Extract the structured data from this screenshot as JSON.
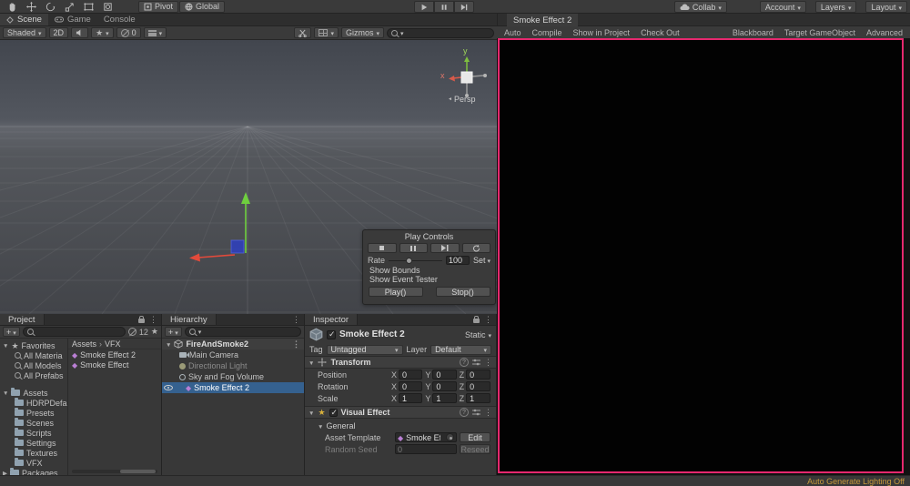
{
  "topbar": {
    "pivot": "Pivot",
    "global": "Global",
    "collab": "Collab",
    "account": "Account",
    "layers": "Layers",
    "layout": "Layout"
  },
  "tabs": {
    "scene": "Scene",
    "game": "Game",
    "console": "Console",
    "vfx": "Smoke Effect 2"
  },
  "scene_toolbar": {
    "shaded": "Shaded",
    "mode2d": "2D",
    "hidden_count": "0",
    "gizmos": "Gizmos"
  },
  "scene_view": {
    "axis_x": "x",
    "axis_y": "y",
    "persp": "Persp"
  },
  "play_controls": {
    "title": "Play Controls",
    "rate": "Rate",
    "rate_value": "100",
    "set": "Set",
    "show_bounds": "Show Bounds",
    "show_event_tester": "Show Event Tester",
    "play": "Play()",
    "stop": "Stop()"
  },
  "vfx_toolbar": {
    "left": [
      "Auto",
      "Compile",
      "Show in Project",
      "Check Out"
    ],
    "right": [
      "Blackboard",
      "Target GameObject",
      "Advanced"
    ]
  },
  "project": {
    "tab": "Project",
    "add": "+",
    "filter_count": "12",
    "favorites": "Favorites",
    "favorite_items": [
      "All Materia",
      "All Models",
      "All Prefabs"
    ],
    "assets": "Assets",
    "folders": [
      "HDRPDefa",
      "Presets",
      "Scenes",
      "Scripts",
      "Settings",
      "Textures",
      "VFX"
    ],
    "packages": "Packages",
    "breadcrumb_root": "Assets",
    "breadcrumb_current": "VFX",
    "files": [
      "Smoke Effect 2",
      "Smoke Effect"
    ]
  },
  "hierarchy": {
    "tab": "Hierarchy",
    "add": "+",
    "scene_root": "FireAndSmoke2",
    "items": [
      "Main Camera",
      "Directional Light",
      "Sky and Fog Volume",
      "Smoke Effect 2"
    ]
  },
  "inspector": {
    "tab": "Inspector",
    "name": "Smoke Effect 2",
    "static": "Static",
    "tag_label": "Tag",
    "tag": "Untagged",
    "layer_label": "Layer",
    "layer": "Default",
    "transform": {
      "title": "Transform",
      "axes": [
        "X",
        "Y",
        "Z"
      ],
      "rows": [
        {
          "label": "Position",
          "x": "0",
          "y": "0",
          "z": "0"
        },
        {
          "label": "Rotation",
          "x": "0",
          "y": "0",
          "z": "0"
        },
        {
          "label": "Scale",
          "x": "1",
          "y": "1",
          "z": "1"
        }
      ]
    },
    "visual_effect": {
      "title": "Visual Effect",
      "general": "General",
      "asset_template_label": "Asset Template",
      "asset_template": "Smoke Effect",
      "edit": "Edit",
      "random_seed_label": "Random Seed",
      "random_seed": "0",
      "reseed": "Reseed"
    }
  },
  "status_bar": {
    "lighting": "Auto Generate Lighting Off"
  },
  "colors": {
    "selection_blue": "#35618F",
    "vfx_border_pink": "#E5286E",
    "lighting_warning_text": "#C89B3C",
    "folder_icon": "#90A2B0",
    "vfx_asset_icon": "#B97FD4"
  }
}
